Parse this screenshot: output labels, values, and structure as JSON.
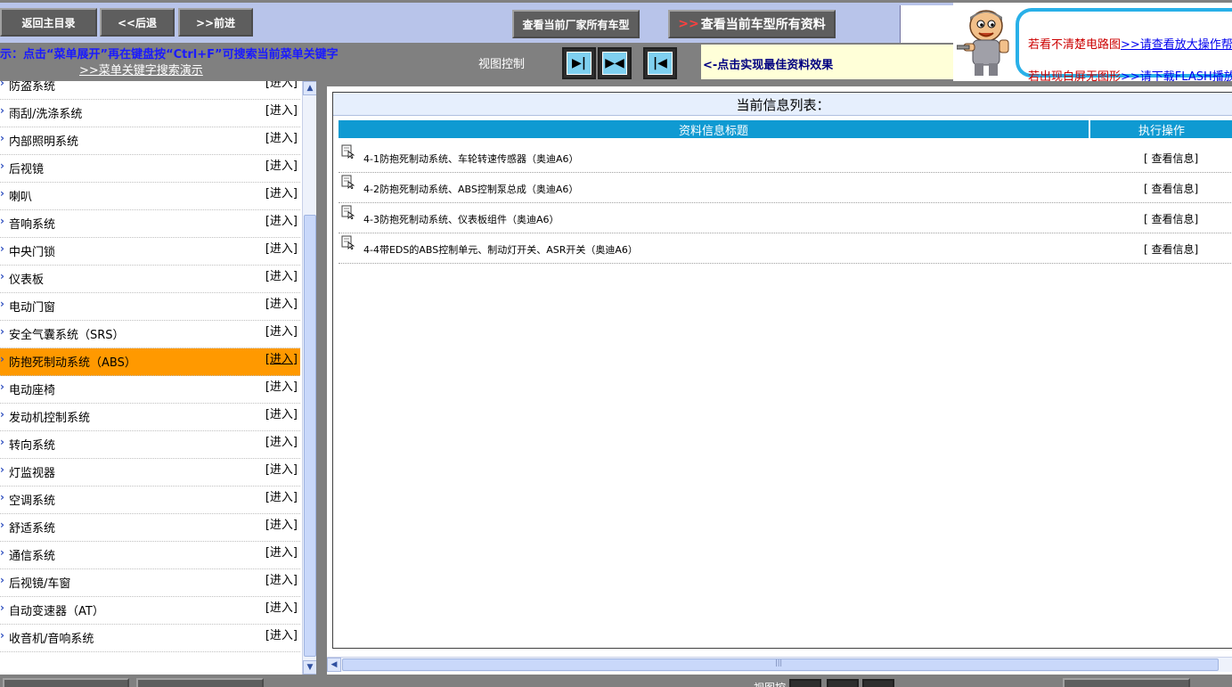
{
  "toolbar": {
    "home_label": "返回主目录",
    "back_label": "<<后退",
    "forward_label": ">>前进",
    "vendor_models_label": "查看当前厂家所有车型",
    "all_info_arrows": ">>",
    "all_info_label": "查看当前车型所有资料"
  },
  "help": {
    "line1_text": "若看不清楚电路图",
    "line1_link": ">>请查看放大操作帮助",
    "line2_text": "若出现白屏无图形",
    "line2_link": ">>请下载FLASH播放"
  },
  "subbar": {
    "tip": "示：点击“菜单展开”再在键盘按“Ctrl+F”可搜索当前菜单关键字",
    "tip_link": ">>菜单关键字搜索演示",
    "view_control_label": "视图控制",
    "view_btn1_glyph": "▶|",
    "view_btn2_glyph": "▶◀",
    "view_btn3_glyph": "|◀",
    "view_hint": "<-点击实现最佳资料效果"
  },
  "menu": {
    "items": [
      {
        "label": "防盗系统",
        "enter": "[进入]"
      },
      {
        "label": "雨刮/洗涤系统",
        "enter": "[进入]"
      },
      {
        "label": "内部照明系统",
        "enter": "[进入]"
      },
      {
        "label": "后视镜",
        "enter": "[进入]"
      },
      {
        "label": "喇叭",
        "enter": "[进入]"
      },
      {
        "label": "音响系统",
        "enter": "[进入]"
      },
      {
        "label": "中央门锁",
        "enter": "[进入]"
      },
      {
        "label": "仪表板",
        "enter": "[进入]"
      },
      {
        "label": "电动门窗",
        "enter": "[进入]"
      },
      {
        "label": "安全气囊系统（SRS）",
        "enter": "[进入]"
      },
      {
        "label": "防抱死制动系统（ABS）",
        "enter": "[进入]",
        "active": true
      },
      {
        "label": "电动座椅",
        "enter": "[进入]"
      },
      {
        "label": "发动机控制系统",
        "enter": "[进入]"
      },
      {
        "label": "转向系统",
        "enter": "[进入]"
      },
      {
        "label": "灯监视器",
        "enter": "[进入]"
      },
      {
        "label": "空调系统",
        "enter": "[进入]"
      },
      {
        "label": "舒适系统",
        "enter": "[进入]"
      },
      {
        "label": "通信系统",
        "enter": "[进入]"
      },
      {
        "label": "后视镜/车窗",
        "enter": "[进入]"
      },
      {
        "label": "自动变速器（AT）",
        "enter": "[进入]"
      },
      {
        "label": "收音机/音响系统",
        "enter": "[进入]"
      }
    ]
  },
  "list": {
    "title": "当前信息列表：",
    "col_title": "资料信息标题",
    "col_action": "执行操作",
    "rows": [
      {
        "title": "4-1防抱死制动系统、车轮转速传感器（奥迪A6）",
        "action": "[ 查看信息]"
      },
      {
        "title": "4-2防抱死制动系统、ABS控制泵总成（奥迪A6）",
        "action": "[ 查看信息]"
      },
      {
        "title": "4-3防抱死制动系统、仪表板组件（奥迪A6）",
        "action": "[ 查看信息]"
      },
      {
        "title": "4-4带EDS的ABS控制单元、制动灯开关、ASR开关（奥迪A6）",
        "action": "[ 查看信息]"
      }
    ]
  },
  "bottom": {
    "view_label": "视图控"
  },
  "colors": {
    "active_menu": "#ff9900",
    "header_blue": "#0f9ad2",
    "toolbar_bg": "#b8c4ea",
    "tip_blue": "#1a1aff",
    "help_red": "#cc0000"
  }
}
